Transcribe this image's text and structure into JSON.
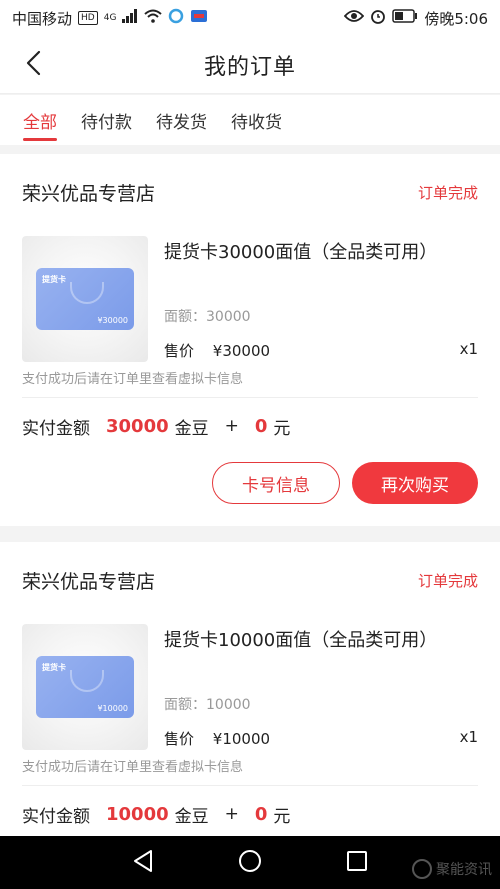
{
  "status_bar": {
    "carrier": "中国移动",
    "hd": "HD",
    "network": "4G",
    "time_label": "傍晚5:06"
  },
  "header": {
    "title": "我的订单",
    "back_icon": "chevron-left-icon"
  },
  "tabs": [
    {
      "label": "全部",
      "active": true
    },
    {
      "label": "待付款",
      "active": false
    },
    {
      "label": "待发货",
      "active": false
    },
    {
      "label": "待收货",
      "active": false
    }
  ],
  "orders": [
    {
      "store": "荣兴优品专营店",
      "status": "订单完成",
      "product": {
        "card_title": "提货卡",
        "card_value": "¥30000",
        "name": "提货卡30000面值（全品类可用）",
        "denomination": "面额：30000",
        "price_label": "售价",
        "price": "¥30000",
        "qty": "x1"
      },
      "note": "支付成功后请在订单里查看虚拟卡信息",
      "paid": {
        "label": "实付金额",
        "beans": "30000",
        "beans_unit": "金豆",
        "plus": "+",
        "cash": "0",
        "cash_unit": "元"
      },
      "actions": {
        "card_info": "卡号信息",
        "rebuy": "再次购买"
      }
    },
    {
      "store": "荣兴优品专营店",
      "status": "订单完成",
      "product": {
        "card_title": "提货卡",
        "card_value": "¥10000",
        "name": "提货卡10000面值（全品类可用）",
        "denomination": "面额：10000",
        "price_label": "售价",
        "price": "¥10000",
        "qty": "x1"
      },
      "note": "支付成功后请在订单里查看虚拟卡信息",
      "paid": {
        "label": "实付金额",
        "beans": "10000",
        "beans_unit": "金豆",
        "plus": "+",
        "cash": "0",
        "cash_unit": "元"
      }
    }
  ],
  "watermark": "聚能资讯",
  "colors": {
    "accent": "#e4393c",
    "button_fill": "#f0393e",
    "card_blue": "#8aa7ee"
  }
}
